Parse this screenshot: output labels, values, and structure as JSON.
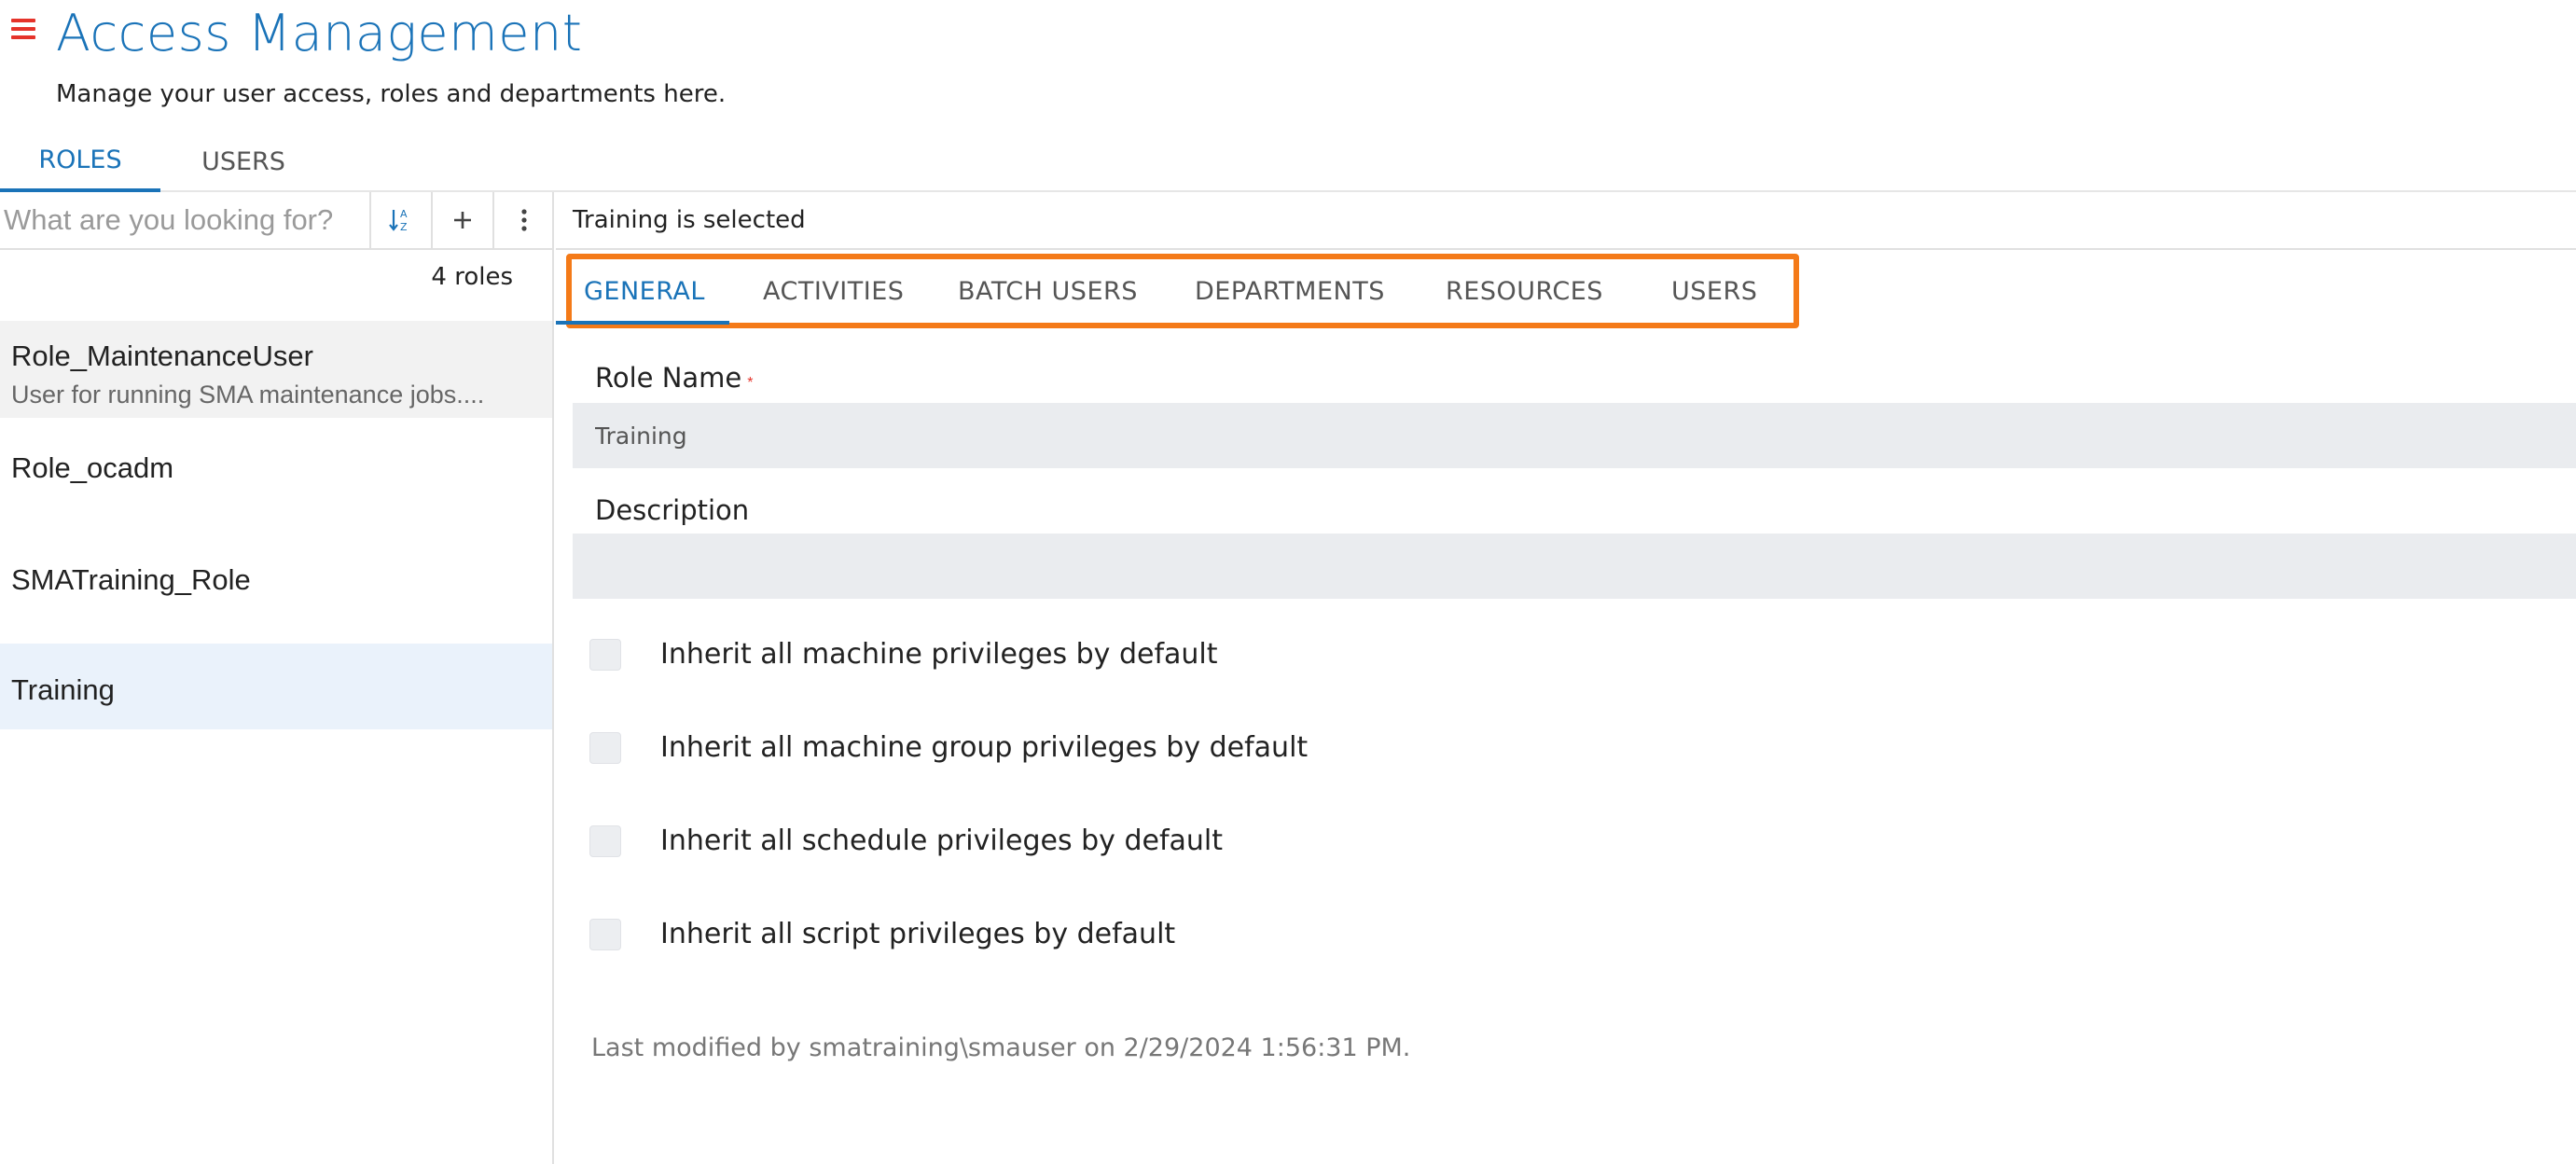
{
  "header": {
    "title": "Access Management",
    "subtitle": "Manage your user access, roles and departments here."
  },
  "top_tabs": [
    {
      "label": "ROLES",
      "active": true
    },
    {
      "label": "USERS",
      "active": false
    }
  ],
  "search": {
    "placeholder": "What are you looking for?",
    "value": ""
  },
  "toolbar": {
    "sort_icon": "sort-az-icon",
    "add_icon": "plus-icon",
    "more_icon": "kebab-menu-icon"
  },
  "roles_count": "4 roles",
  "roles": [
    {
      "name": "Role_MaintenanceUser",
      "description": "User for running SMA maintenance jobs....",
      "selected": false,
      "hovered": true
    },
    {
      "name": "Role_ocadm",
      "description": "",
      "selected": false
    },
    {
      "name": "SMATraining_Role",
      "description": "",
      "selected": false
    },
    {
      "name": "Training",
      "description": "",
      "selected": true
    }
  ],
  "status_text": "Training is selected",
  "detail_tabs": [
    {
      "label": "GENERAL",
      "active": true
    },
    {
      "label": "ACTIVITIES",
      "active": false
    },
    {
      "label": "BATCH USERS",
      "active": false
    },
    {
      "label": "DEPARTMENTS",
      "active": false
    },
    {
      "label": "RESOURCES",
      "active": false
    },
    {
      "label": "USERS",
      "active": false
    }
  ],
  "form": {
    "role_name_label": "Role Name",
    "required_mark": "*",
    "role_name_value": "Training",
    "description_label": "Description",
    "description_value": ""
  },
  "checkboxes": [
    {
      "label": "Inherit all machine privileges by default",
      "checked": false
    },
    {
      "label": "Inherit all machine group privileges by default",
      "checked": false
    },
    {
      "label": "Inherit all schedule privileges by default",
      "checked": false
    },
    {
      "label": "Inherit all script privileges by default",
      "checked": false
    }
  ],
  "last_modified": "Last modified by smatraining\\smauser on 2/29/2024 1:56:31 PM.",
  "colors": {
    "accent": "#1a73b8",
    "highlight": "#f47a18",
    "menu": "#e5332a",
    "selected_row": "#eaf2fb",
    "hover_row": "#f2f2f2"
  }
}
